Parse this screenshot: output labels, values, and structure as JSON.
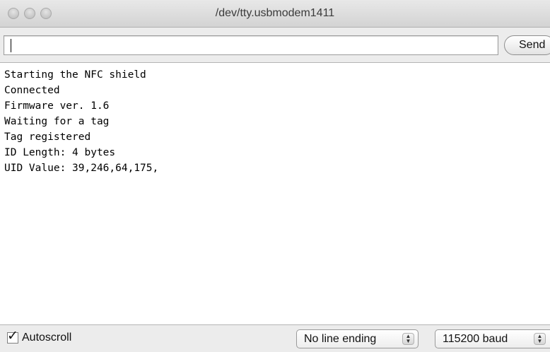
{
  "window": {
    "title": "/dev/tty.usbmodem1411"
  },
  "send": {
    "input_value": "",
    "button_label": "Send"
  },
  "console": {
    "lines": [
      "Starting the NFC shield",
      "Connected",
      "Firmware ver. 1.6",
      "Waiting for a tag",
      "Tag registered",
      "ID Length: 4 bytes",
      "UID Value: 39,246,64,175,"
    ]
  },
  "footer": {
    "autoscroll_label": "Autoscroll",
    "autoscroll_checked": true,
    "line_ending": "No line ending",
    "baud_rate": "115200 baud"
  },
  "icons": {
    "checkmark": "checkmark-icon",
    "stepper": "up-down-arrows-icon"
  }
}
